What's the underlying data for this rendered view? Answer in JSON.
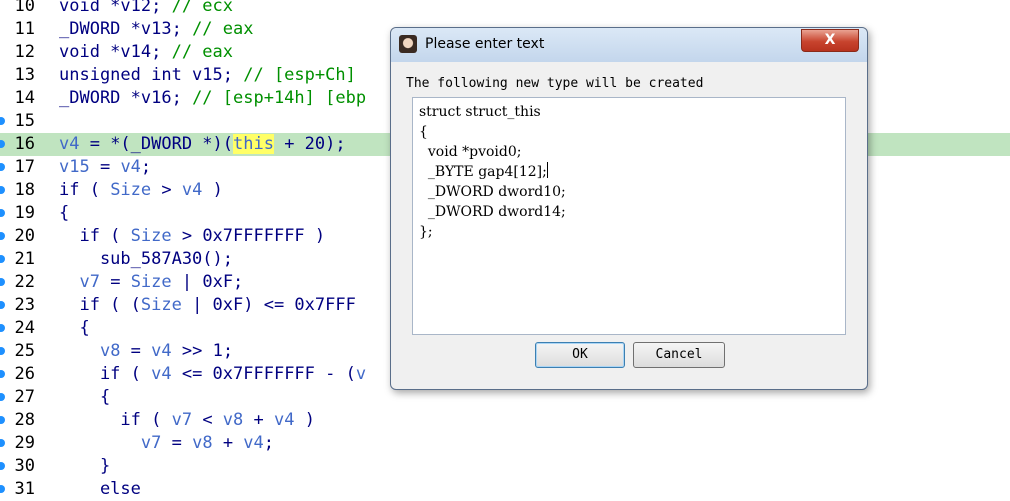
{
  "code_lines": [
    {
      "num": "10",
      "dot": false,
      "hl": false,
      "segments": [
        {
          "t": "void *v12; ",
          "c": "k"
        },
        {
          "t": "// ecx",
          "c": "c"
        }
      ]
    },
    {
      "num": "11",
      "dot": false,
      "hl": false,
      "segments": [
        {
          "t": "_DWORD *v13; ",
          "c": "k"
        },
        {
          "t": "// eax",
          "c": "c"
        }
      ]
    },
    {
      "num": "12",
      "dot": false,
      "hl": false,
      "segments": [
        {
          "t": "void *v14; ",
          "c": "k"
        },
        {
          "t": "// eax",
          "c": "c"
        }
      ]
    },
    {
      "num": "13",
      "dot": false,
      "hl": false,
      "segments": [
        {
          "t": "unsigned int v15; ",
          "c": "k"
        },
        {
          "t": "// [esp+Ch]",
          "c": "c"
        }
      ]
    },
    {
      "num": "14",
      "dot": false,
      "hl": false,
      "segments": [
        {
          "t": "_DWORD *v16; ",
          "c": "k"
        },
        {
          "t": "// [esp+14h] [ebp",
          "c": "c"
        }
      ]
    },
    {
      "num": "15",
      "dot": true,
      "hl": false,
      "segments": []
    },
    {
      "num": "16",
      "dot": true,
      "hl": true,
      "segments": [
        {
          "t": "v4",
          "c": "v"
        },
        {
          "t": " = *(_DWORD *)(",
          "c": "k"
        },
        {
          "t": "this",
          "c": "hw"
        },
        {
          "t": " + 20);",
          "c": "k"
        }
      ]
    },
    {
      "num": "17",
      "dot": true,
      "hl": false,
      "segments": [
        {
          "t": "v15",
          "c": "v"
        },
        {
          "t": " = ",
          "c": "k"
        },
        {
          "t": "v4",
          "c": "v"
        },
        {
          "t": ";",
          "c": "k"
        }
      ]
    },
    {
      "num": "18",
      "dot": true,
      "hl": false,
      "segments": [
        {
          "t": "if ( ",
          "c": "k"
        },
        {
          "t": "Size",
          "c": "v"
        },
        {
          "t": " > ",
          "c": "k"
        },
        {
          "t": "v4",
          "c": "v"
        },
        {
          "t": " )",
          "c": "k"
        }
      ]
    },
    {
      "num": "19",
      "dot": true,
      "hl": false,
      "segments": [
        {
          "t": "{",
          "c": "k"
        }
      ]
    },
    {
      "num": "20",
      "dot": true,
      "hl": false,
      "segments": [
        {
          "t": "  if ( ",
          "c": "k"
        },
        {
          "t": "Size",
          "c": "v"
        },
        {
          "t": " > 0x7FFFFFFF )",
          "c": "k"
        }
      ]
    },
    {
      "num": "21",
      "dot": true,
      "hl": false,
      "segments": [
        {
          "t": "    sub_587A30();",
          "c": "k"
        }
      ]
    },
    {
      "num": "22",
      "dot": true,
      "hl": false,
      "segments": [
        {
          "t": "  ",
          "c": "k"
        },
        {
          "t": "v7",
          "c": "v"
        },
        {
          "t": " = ",
          "c": "k"
        },
        {
          "t": "Size",
          "c": "v"
        },
        {
          "t": " | 0xF;",
          "c": "k"
        }
      ]
    },
    {
      "num": "23",
      "dot": true,
      "hl": false,
      "segments": [
        {
          "t": "  if ( (",
          "c": "k"
        },
        {
          "t": "Size",
          "c": "v"
        },
        {
          "t": " | 0xF) <= 0x7FFF",
          "c": "k"
        }
      ]
    },
    {
      "num": "24",
      "dot": true,
      "hl": false,
      "segments": [
        {
          "t": "  {",
          "c": "k"
        }
      ]
    },
    {
      "num": "25",
      "dot": true,
      "hl": false,
      "segments": [
        {
          "t": "    ",
          "c": "k"
        },
        {
          "t": "v8",
          "c": "v"
        },
        {
          "t": " = ",
          "c": "k"
        },
        {
          "t": "v4",
          "c": "v"
        },
        {
          "t": " >> 1;",
          "c": "k"
        }
      ]
    },
    {
      "num": "26",
      "dot": true,
      "hl": false,
      "segments": [
        {
          "t": "    if ( ",
          "c": "k"
        },
        {
          "t": "v4",
          "c": "v"
        },
        {
          "t": " <= 0x7FFFFFFF - (",
          "c": "k"
        },
        {
          "t": "v",
          "c": "v"
        }
      ]
    },
    {
      "num": "27",
      "dot": true,
      "hl": false,
      "segments": [
        {
          "t": "    {",
          "c": "k"
        }
      ]
    },
    {
      "num": "28",
      "dot": true,
      "hl": false,
      "segments": [
        {
          "t": "      if ( ",
          "c": "k"
        },
        {
          "t": "v7",
          "c": "v"
        },
        {
          "t": " < ",
          "c": "k"
        },
        {
          "t": "v8",
          "c": "v"
        },
        {
          "t": " + ",
          "c": "k"
        },
        {
          "t": "v4",
          "c": "v"
        },
        {
          "t": " )",
          "c": "k"
        }
      ]
    },
    {
      "num": "29",
      "dot": true,
      "hl": false,
      "segments": [
        {
          "t": "        ",
          "c": "k"
        },
        {
          "t": "v7",
          "c": "v"
        },
        {
          "t": " = ",
          "c": "k"
        },
        {
          "t": "v8",
          "c": "v"
        },
        {
          "t": " + ",
          "c": "k"
        },
        {
          "t": "v4",
          "c": "v"
        },
        {
          "t": ";",
          "c": "k"
        }
      ]
    },
    {
      "num": "30",
      "dot": true,
      "hl": false,
      "segments": [
        {
          "t": "    }",
          "c": "k"
        }
      ]
    },
    {
      "num": "31",
      "dot": true,
      "hl": false,
      "segments": [
        {
          "t": "    else",
          "c": "k"
        }
      ]
    }
  ],
  "dialog": {
    "title": "Please enter text",
    "close_label": "X",
    "prompt": "The following new type will be created",
    "editor_lines": [
      "struct struct_this",
      "{",
      "  void *pvoid0;",
      "  _BYTE gap4[12];",
      "  _DWORD dword10;",
      "  _DWORD dword14;",
      "};"
    ],
    "ok_label": "OK",
    "cancel_label": "Cancel"
  },
  "colors": {
    "highlight_line": "#c0e4c0",
    "highlight_word": "#ffff66",
    "comment": "#009000",
    "variable": "#4169c8",
    "keyword": "#000080"
  }
}
